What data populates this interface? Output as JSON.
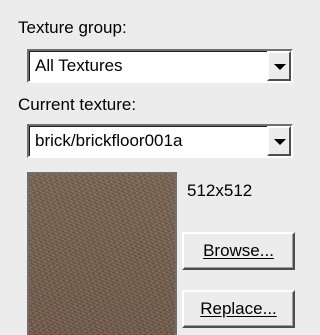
{
  "texture_group": {
    "label": "Texture group:",
    "value": "All Textures"
  },
  "current_texture": {
    "label": "Current texture:",
    "value": "brick/brickfloor001a",
    "dimensions": "512x512"
  },
  "buttons": {
    "browse_label": "Browse...",
    "replace_label": "Replace..."
  },
  "icons": {
    "dropdown": "chevron-down-icon"
  }
}
